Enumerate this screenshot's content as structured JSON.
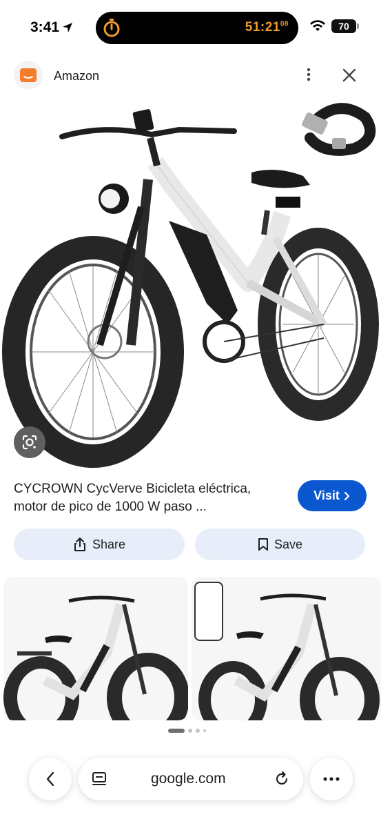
{
  "status_bar": {
    "time": "3:41",
    "timer_main": "51:21",
    "timer_fraction": "08",
    "battery": "70"
  },
  "source": {
    "name": "Amazon"
  },
  "product": {
    "title": "CYCROWN CycVerve Bicicleta eléctrica, motor de pico de 1000 W paso ...",
    "visit_label": "Visit"
  },
  "actions": {
    "share_label": "Share",
    "save_label": "Save"
  },
  "pagination": {
    "current": 1,
    "total": 4
  },
  "browser": {
    "url": "google.com"
  },
  "colors": {
    "accent": "#0b57d0",
    "action_bg": "#e8eef9",
    "timer": "#f29c2c",
    "brand": "#f57c2b"
  }
}
